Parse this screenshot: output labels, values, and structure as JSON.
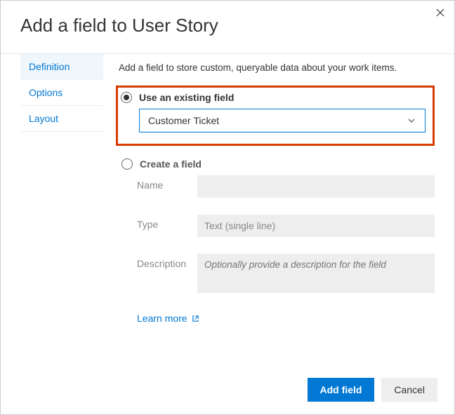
{
  "dialog": {
    "title": "Add a field to User Story",
    "intro": "Add a field to store custom, queryable data about your work items."
  },
  "tabs": {
    "definition": "Definition",
    "options": "Options",
    "layout": "Layout"
  },
  "radios": {
    "existing_label": "Use an existing field",
    "create_label": "Create a field"
  },
  "dropdown": {
    "selected": "Customer Ticket"
  },
  "form": {
    "name_label": "Name",
    "name_value": "",
    "type_label": "Type",
    "type_value": "Text (single line)",
    "desc_label": "Description",
    "desc_placeholder": "Optionally provide a description for the field"
  },
  "links": {
    "learn_more": "Learn more"
  },
  "buttons": {
    "add_field": "Add field",
    "cancel": "Cancel"
  }
}
